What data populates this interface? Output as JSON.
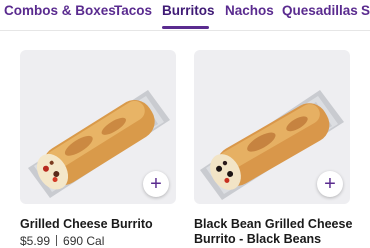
{
  "tabs": [
    {
      "label": "Combos & Boxes",
      "active": false
    },
    {
      "label": "Tacos",
      "active": false
    },
    {
      "label": "Burritos",
      "active": true
    },
    {
      "label": "Nachos",
      "active": false
    },
    {
      "label": "Quesadillas",
      "active": false
    },
    {
      "label": "S",
      "active": false
    }
  ],
  "products": [
    {
      "name": "Grilled Cheese Burrito",
      "price": "$5.99",
      "calories": "690 Cal",
      "add_symbol": "+"
    },
    {
      "name_line1": "Black Bean Grilled Cheese",
      "name_line2": "Burrito - Black Beans",
      "add_symbol": "+"
    }
  ],
  "colors": {
    "brand": "#5a2b8f",
    "card_bg": "#eeeef1"
  }
}
